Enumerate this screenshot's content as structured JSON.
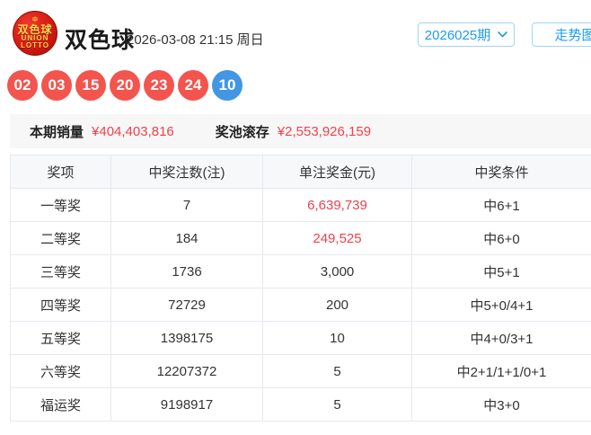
{
  "header": {
    "logo": {
      "badge": "中",
      "cn": "双色球",
      "en1": "UNION",
      "en2": "LOTTO"
    },
    "title": "双色球",
    "datetime": "2026-03-08 21:15 周日",
    "period_selected": "2026025期",
    "trend_button": "走势图"
  },
  "balls": {
    "red": [
      "02",
      "03",
      "15",
      "20",
      "23",
      "24"
    ],
    "blue": [
      "10"
    ]
  },
  "summary": {
    "sales_label": "本期销量",
    "sales_value": "¥404,403,816",
    "pool_label": "奖池滚存",
    "pool_value": "¥2,553,926,159"
  },
  "prize_table": {
    "headers": [
      "奖项",
      "中奖注数(注)",
      "单注奖金(元)",
      "中奖条件"
    ],
    "rows": [
      {
        "prize": "一等奖",
        "count": "7",
        "amount": "6,639,739",
        "amount_highlight": true,
        "condition": "中6+1"
      },
      {
        "prize": "二等奖",
        "count": "184",
        "amount": "249,525",
        "amount_highlight": true,
        "condition": "中6+0"
      },
      {
        "prize": "三等奖",
        "count": "1736",
        "amount": "3,000",
        "amount_highlight": false,
        "condition": "中5+1"
      },
      {
        "prize": "四等奖",
        "count": "72729",
        "amount": "200",
        "amount_highlight": false,
        "condition": "中5+0/4+1"
      },
      {
        "prize": "五等奖",
        "count": "1398175",
        "amount": "10",
        "amount_highlight": false,
        "condition": "中4+0/3+1"
      },
      {
        "prize": "六等奖",
        "count": "12207372",
        "amount": "5",
        "amount_highlight": false,
        "condition": "中2+1/1+1/0+1"
      },
      {
        "prize": "福运奖",
        "count": "9198917",
        "amount": "5",
        "amount_highlight": false,
        "condition": "中3+0"
      }
    ]
  },
  "colors": {
    "accent_blue": "#1b9df2",
    "accent_blue_border": "#9ed5f6",
    "highlight_red": "#f0414b",
    "ball_red": "#f4544e",
    "ball_blue": "#4296e4",
    "summary_bg": "#f7f7f7",
    "table_border": "#e6e9f0",
    "table_header_bg": "#f7f8fa",
    "text_dark": "#333333"
  }
}
